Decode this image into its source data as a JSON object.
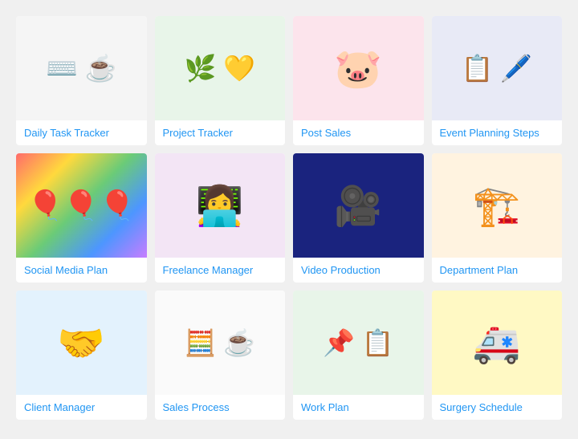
{
  "cards": [
    {
      "id": "daily-task",
      "label": "Daily Task Tracker",
      "imgClass": "img-daily-task"
    },
    {
      "id": "project-tracker",
      "label": "Project Tracker",
      "imgClass": "img-project-tracker"
    },
    {
      "id": "post-sales",
      "label": "Post Sales",
      "imgClass": "img-post-sales"
    },
    {
      "id": "event-planning",
      "label": "Event Planning Steps",
      "imgClass": "img-event-planning"
    },
    {
      "id": "social-media",
      "label": "Social Media Plan",
      "imgClass": "img-social-media"
    },
    {
      "id": "freelance",
      "label": "Freelance Manager",
      "imgClass": "img-freelance"
    },
    {
      "id": "video-production",
      "label": "Video Production",
      "imgClass": "img-video-production"
    },
    {
      "id": "department-plan",
      "label": "Department Plan",
      "imgClass": "img-department-plan"
    },
    {
      "id": "client-manager",
      "label": "Client Manager",
      "imgClass": "img-client-manager"
    },
    {
      "id": "sales-process",
      "label": "Sales Process",
      "imgClass": "img-sales-process"
    },
    {
      "id": "work-plan",
      "label": "Work Plan",
      "imgClass": "img-work-plan"
    },
    {
      "id": "surgery-schedule",
      "label": "Surgery Schedule",
      "imgClass": "img-surgery-schedule"
    }
  ]
}
